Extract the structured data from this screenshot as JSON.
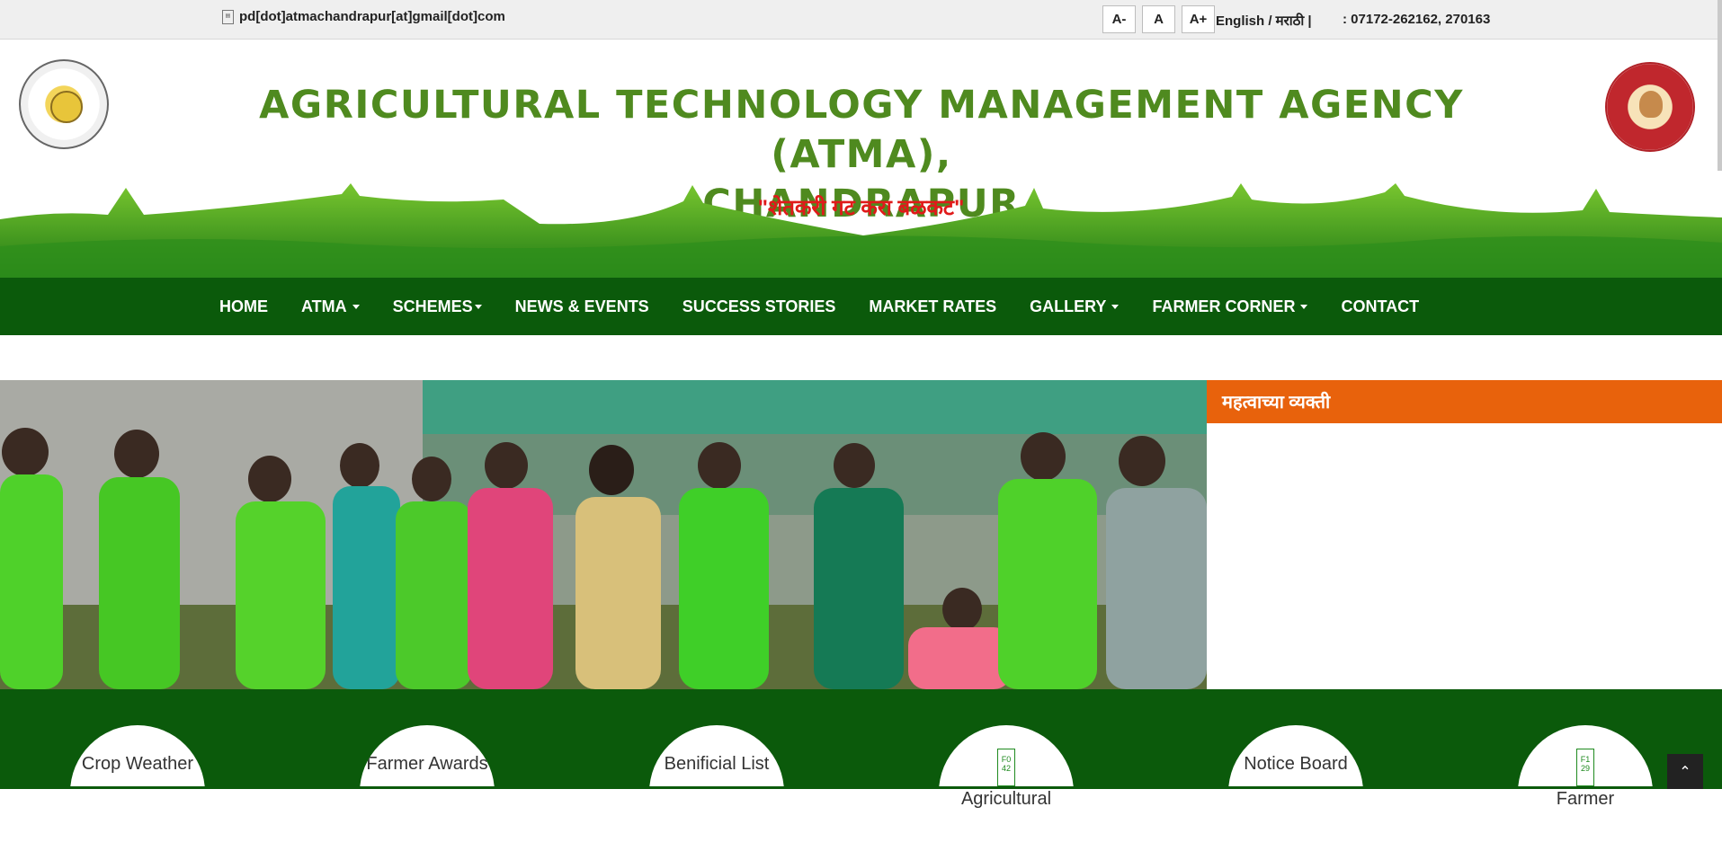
{
  "topbar": {
    "email": "pd[dot]atmachandrapur[at]gmail[dot]com",
    "font_small": "A-",
    "font_normal": "A",
    "font_large": "A+",
    "language": "English / मराठी |",
    "phone": ": 07172-262162, 270163"
  },
  "header": {
    "title_line1": "AGRICULTURAL TECHNOLOGY MANAGEMENT AGENCY (ATMA),",
    "title_line2": "CHANDRAPUR",
    "tagline": "\"शेतकरी गट करा बळकट\""
  },
  "nav": {
    "items": [
      {
        "label": "HOME"
      },
      {
        "label": "ATMA"
      },
      {
        "label": "SCHEMES"
      },
      {
        "label": "NEWS & EVENTS"
      },
      {
        "label": "SUCCESS STORIES"
      },
      {
        "label": "MARKET RATES"
      },
      {
        "label": "GALLERY"
      },
      {
        "label": "FARMER CORNER"
      },
      {
        "label": "CONTACT"
      }
    ]
  },
  "side_panel": {
    "heading": "महत्वाच्या व्यक्ती"
  },
  "tiles": [
    {
      "label": "Crop Weather"
    },
    {
      "label": "Farmer Awards"
    },
    {
      "label": "Benificial List"
    },
    {
      "label": "Agricultural",
      "icon_text": "F0 42"
    },
    {
      "label": "Notice Board"
    },
    {
      "label": "Farmer",
      "icon_text": "F1 29"
    }
  ],
  "colors": {
    "nav_green": "#0b5a0b",
    "title_green": "#4f8a1f",
    "tagline_red": "#e01a1a",
    "panel_orange": "#e8620c"
  }
}
